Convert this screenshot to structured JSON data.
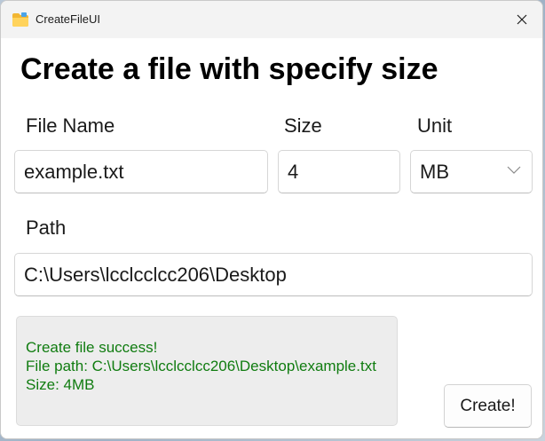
{
  "window": {
    "title": "CreateFileUI",
    "app_icon": "folder-icon",
    "close_icon": "close-icon"
  },
  "form": {
    "heading": "Create a file with specify size",
    "file_name_label": "File Name",
    "file_name_value": "example.txt",
    "size_label": "Size",
    "size_value": "4",
    "unit_label": "Unit",
    "unit_value": "MB",
    "path_label": "Path",
    "path_value": "C:\\Users\\lcclcclcc206\\Desktop"
  },
  "result": {
    "line1": "Create file success!",
    "line2": "File path: C:\\Users\\lcclcclcc206\\Desktop\\example.txt",
    "line3": "Size: 4MB",
    "color": "#107c10"
  },
  "create_button_label": "Create!"
}
